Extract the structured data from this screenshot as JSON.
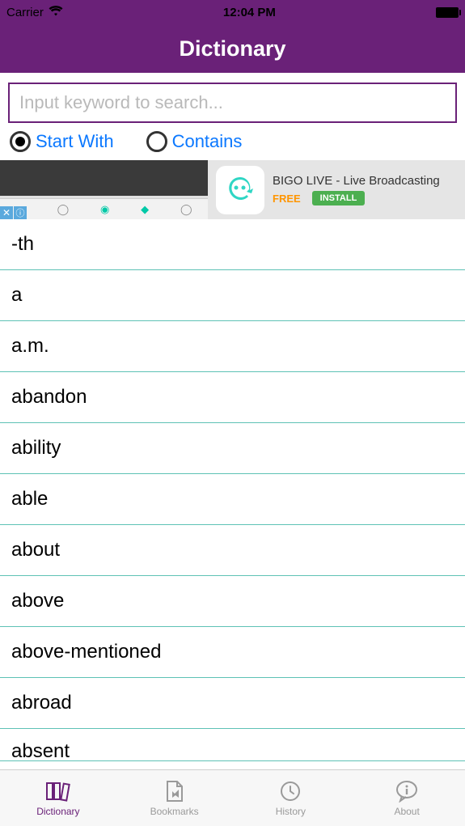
{
  "status": {
    "carrier": "Carrier",
    "time": "12:04 PM"
  },
  "header": {
    "title": "Dictionary"
  },
  "search": {
    "placeholder": "Input keyword to search...",
    "value": ""
  },
  "filter": {
    "options": [
      {
        "label": "Start With",
        "selected": true
      },
      {
        "label": "Contains",
        "selected": false
      }
    ]
  },
  "ad": {
    "title": "BIGO LIVE - Live Broadcasting",
    "price": "FREE",
    "cta": "INSTALL"
  },
  "words": [
    "-th",
    "a",
    "a.m.",
    "abandon",
    "ability",
    "able",
    "about",
    "above",
    "above-mentioned",
    "abroad",
    "absent"
  ],
  "tabs": [
    {
      "label": "Dictionary",
      "icon": "books-icon",
      "active": true
    },
    {
      "label": "Bookmarks",
      "icon": "bookmark-file-icon",
      "active": false
    },
    {
      "label": "History",
      "icon": "clock-icon",
      "active": false
    },
    {
      "label": "About",
      "icon": "info-bubble-icon",
      "active": false
    }
  ]
}
